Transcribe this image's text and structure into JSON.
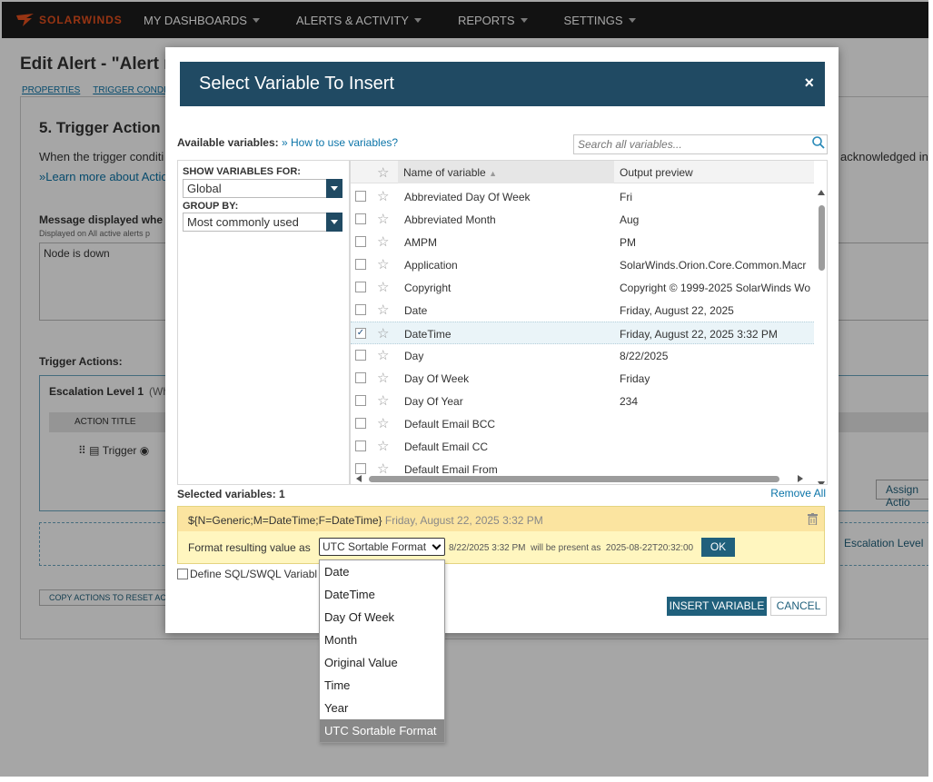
{
  "nav": {
    "brand": "SOLARWINDS",
    "items": [
      "MY DASHBOARDS",
      "ALERTS & ACTIVITY",
      "REPORTS",
      "SETTINGS"
    ]
  },
  "page": {
    "title": "Edit Alert - \"Alert r",
    "breadcrumbs": [
      "PROPERTIES",
      "TRIGGER CONDI"
    ],
    "section_title": "5. Trigger Action",
    "intro": "When the trigger conditi",
    "intro_right": "acknowledged in y",
    "learn_more": "»Learn more about Action",
    "msg_label": "Message displayed whe",
    "msg_sub": "Displayed on All active alerts p",
    "msg_value": "Node is down",
    "trigger_actions": "Trigger Actions:",
    "escalation": "Escalation Level 1",
    "escalation_rest": "(Wh",
    "action_title_col": "ACTION TITLE",
    "action_row": "Trigger",
    "assign_action": "Assign Actio",
    "add_escalation": "Escalation Level",
    "copy_actions": "COPY ACTIONS TO RESET ACTIO"
  },
  "dialog": {
    "title": "Select Variable To Insert",
    "close": "×",
    "available_label": "Available variables:",
    "how_to": "» How to use variables?",
    "search_placeholder": "Search all variables...",
    "show_for_label": "SHOW VARIABLES FOR:",
    "show_for_value": "Global",
    "group_by_label": "GROUP BY:",
    "group_by_value": "Most commonly used",
    "col_name": "Name of variable",
    "col_output": "Output preview",
    "rows": [
      {
        "name": "Abbreviated Day Of Week",
        "output": "Fri",
        "checked": false
      },
      {
        "name": "Abbreviated Month",
        "output": "Aug",
        "checked": false
      },
      {
        "name": "AMPM",
        "output": "PM",
        "checked": false
      },
      {
        "name": "Application",
        "output": "SolarWinds.Orion.Core.Common.Macr",
        "checked": false
      },
      {
        "name": "Copyright",
        "output": "Copyright © 1999-2025 SolarWinds Wo",
        "checked": false
      },
      {
        "name": "Date",
        "output": "Friday, August 22, 2025",
        "checked": false
      },
      {
        "name": "DateTime",
        "output": "Friday, August 22, 2025 3:32 PM",
        "checked": true
      },
      {
        "name": "Day",
        "output": "8/22/2025",
        "checked": false
      },
      {
        "name": "Day Of Week",
        "output": "Friday",
        "checked": false
      },
      {
        "name": "Day Of Year",
        "output": "234",
        "checked": false
      },
      {
        "name": "Default Email BCC",
        "output": "",
        "checked": false
      },
      {
        "name": "Default Email CC",
        "output": "",
        "checked": false
      },
      {
        "name": "Default Email From",
        "output": "",
        "checked": false
      }
    ],
    "selected_label": "Selected variables: 1",
    "remove_all": "Remove All",
    "selected_code": "${N=Generic;M=DateTime;F=DateTime}",
    "selected_preview": "Friday, August 22, 2025 3:32 PM",
    "format_label": "Format resulting value as",
    "format_value": "UTC Sortable Format",
    "format_example_from": "8/22/2025 3:32 PM",
    "format_example_mid": "will be present as",
    "format_example_to": "2025-08-22T20:32:00",
    "ok": "OK",
    "define_sql": "Define SQL/SWQL Variabl",
    "insert": "INSERT VARIABLE",
    "cancel": "CANCEL",
    "format_options": [
      "Date",
      "DateTime",
      "Day Of Week",
      "Month",
      "Original Value",
      "Time",
      "Year",
      "UTC Sortable Format"
    ],
    "format_highlighted_index": 7
  },
  "colors": {
    "header": "#204a63",
    "button": "#20607c",
    "link": "#0b74a8",
    "brand": "#e8501e"
  }
}
